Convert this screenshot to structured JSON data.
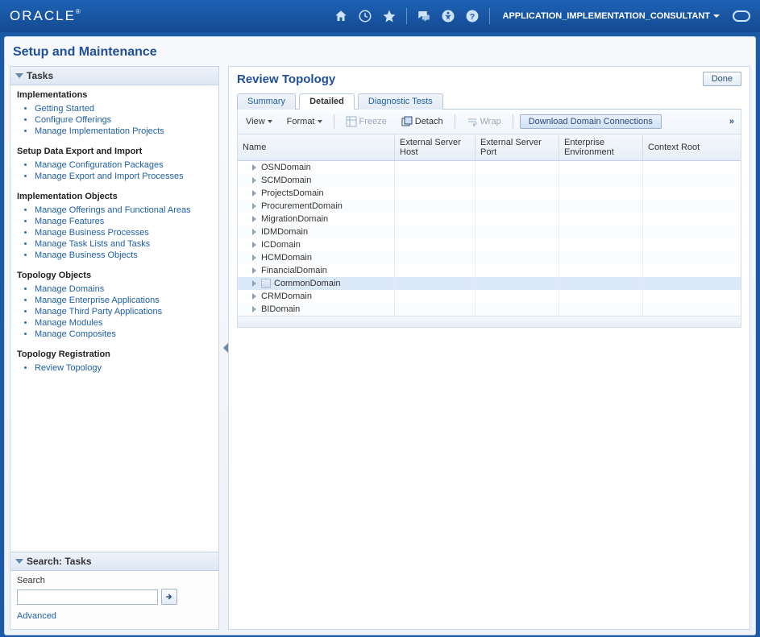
{
  "header": {
    "logo": "ORACLE",
    "user_label": "APPLICATION_IMPLEMENTATION_CONSULTANT"
  },
  "page": {
    "title": "Setup and Maintenance"
  },
  "sidebar": {
    "tasks_header": "Tasks",
    "sections": [
      {
        "title": "Implementations",
        "items": [
          "Getting Started",
          "Configure Offerings",
          "Manage Implementation Projects"
        ]
      },
      {
        "title": "Setup Data Export and Import",
        "items": [
          "Manage Configuration Packages",
          "Manage Export and Import Processes"
        ]
      },
      {
        "title": "Implementation Objects",
        "items": [
          "Manage Offerings and Functional Areas",
          "Manage Features",
          "Manage Business Processes",
          "Manage Task Lists and Tasks",
          "Manage Business Objects"
        ]
      },
      {
        "title": "Topology Objects",
        "items": [
          "Manage Domains",
          "Manage Enterprise Applications",
          "Manage Third Party Applications",
          "Manage Modules",
          "Manage Composites"
        ]
      },
      {
        "title": "Topology Registration",
        "items": [
          "Review Topology"
        ]
      }
    ],
    "search_header": "Search: Tasks",
    "search_label": "Search",
    "search_value": "",
    "advanced_label": "Advanced"
  },
  "main": {
    "title": "Review Topology",
    "done_label": "Done",
    "tabs": [
      "Summary",
      "Detailed",
      "Diagnostic Tests"
    ],
    "active_tab_index": 1,
    "toolbar": {
      "view": "View",
      "format": "Format",
      "freeze": "Freeze",
      "detach": "Detach",
      "wrap": "Wrap",
      "download": "Download Domain Connections"
    },
    "columns": [
      "Name",
      "External Server Host",
      "External Server Port",
      "Enterprise Environment",
      "Context Root"
    ],
    "rows": [
      {
        "name": "OSNDomain",
        "selected": false
      },
      {
        "name": "SCMDomain",
        "selected": false
      },
      {
        "name": "ProjectsDomain",
        "selected": false
      },
      {
        "name": "ProcurementDomain",
        "selected": false
      },
      {
        "name": "MigrationDomain",
        "selected": false
      },
      {
        "name": "IDMDomain",
        "selected": false
      },
      {
        "name": "ICDomain",
        "selected": false
      },
      {
        "name": "HCMDomain",
        "selected": false
      },
      {
        "name": "FinancialDomain",
        "selected": false
      },
      {
        "name": "CommonDomain",
        "selected": true
      },
      {
        "name": "CRMDomain",
        "selected": false
      },
      {
        "name": "BIDomain",
        "selected": false
      }
    ]
  }
}
